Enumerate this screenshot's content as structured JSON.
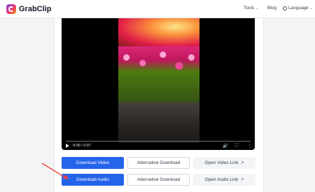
{
  "app": {
    "name": "GrabClip"
  },
  "nav": {
    "tools": "Tools",
    "blog": "Blog",
    "language": "Language"
  },
  "player": {
    "time": "0:00 / 0:07"
  },
  "buttons": {
    "download_video": "Download Video",
    "alt_download_1": "Alternative Download",
    "open_video_link": "Open Video Link",
    "download_audio": "Download Audio",
    "alt_download_2": "Alternative Download",
    "open_audio_link": "Open Audio Link"
  },
  "colors": {
    "primary": "#2563eb",
    "annotation": "#ef4444"
  }
}
